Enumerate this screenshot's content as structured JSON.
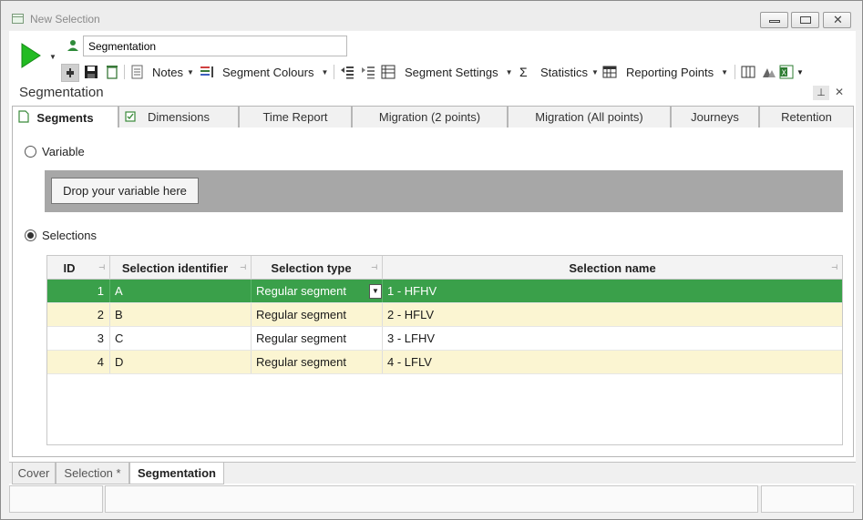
{
  "window": {
    "title": "New Selection"
  },
  "toolbar": {
    "name_value": "Segmentation",
    "notes_label": "Notes",
    "segment_colours_label": "Segment Colours",
    "segment_settings_label": "Segment Settings",
    "statistics_label": "Statistics",
    "reporting_points_label": "Reporting Points"
  },
  "panel": {
    "title": "Segmentation"
  },
  "tabs": [
    {
      "label": "Segments",
      "active": true
    },
    {
      "label": "Dimensions",
      "active": false
    },
    {
      "label": "Time Report",
      "active": false
    },
    {
      "label": "Migration (2 points)",
      "active": false
    },
    {
      "label": "Migration (All points)",
      "active": false
    },
    {
      "label": "Journeys",
      "active": false
    },
    {
      "label": "Retention",
      "active": false
    }
  ],
  "segments": {
    "variable_label": "Variable",
    "drop_label": "Drop your variable here",
    "selections_label": "Selections",
    "selected_option": "Selections"
  },
  "grid": {
    "columns": [
      "ID",
      "Selection identifier",
      "Selection type",
      "Selection name"
    ],
    "rows": [
      {
        "id": "1",
        "identifier": "A",
        "type": "Regular segment",
        "name": "1 - HFHV"
      },
      {
        "id": "2",
        "identifier": "B",
        "type": "Regular segment",
        "name": "2 - HFLV"
      },
      {
        "id": "3",
        "identifier": "C",
        "type": "Regular segment",
        "name": "3 - LFHV"
      },
      {
        "id": "4",
        "identifier": "D",
        "type": "Regular segment",
        "name": "4 - LFLV"
      }
    ]
  },
  "bottom_tabs": [
    {
      "label": "Cover",
      "active": false
    },
    {
      "label": "Selection *",
      "active": false
    },
    {
      "label": "Segmentation",
      "active": true
    }
  ],
  "colors": {
    "selected_row": "#3aa04a",
    "alt_row": "#fbf5d2",
    "run_button": "#22bb22",
    "dropzone": "#a7a7a7"
  }
}
